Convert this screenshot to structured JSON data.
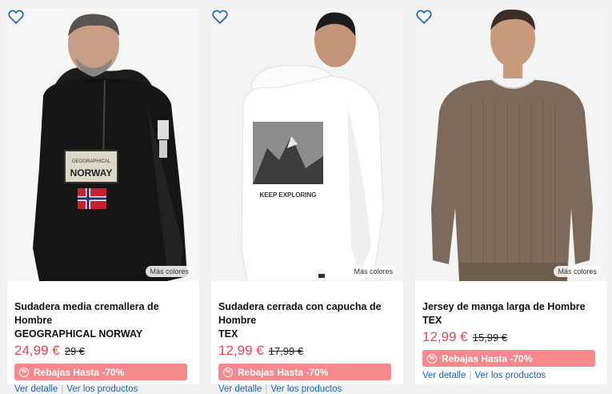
{
  "products": [
    {
      "title_line1": "Sudadera media cremallera de Hombre",
      "title_line2": "GEOGRAPHICAL NORWAY",
      "price": "24,99 €",
      "old_price": "29 €",
      "promo": "Rebajas Hasta -70%",
      "more_colors": "Más colores",
      "link_detail": "Ver detalle",
      "link_products": "Ver los productos",
      "print_text": "NORWAY",
      "print_small": "GEOGRAPHICAL"
    },
    {
      "title_line1": "Sudadera cerrada con capucha de Hombre",
      "title_line2": "TEX",
      "price": "12,99 €",
      "old_price": "17,99 €",
      "promo": "Rebajas Hasta -70%",
      "more_colors": "Más colores",
      "link_detail": "Ver detalle",
      "link_products": "Ver los productos",
      "print_text": "KEEP EXPLORING"
    },
    {
      "title_line1": "Jersey de manga larga de Hombre TEX",
      "price": "12,99 €",
      "old_price": "15,99 €",
      "promo": "Rebajas Hasta -70%",
      "more_colors": "Más colores",
      "link_detail": "Ver detalle",
      "link_products": "Ver los productos"
    }
  ],
  "colors": {
    "price": "#e8484f",
    "promo_bg": "#f5898b",
    "link": "#1a63b5",
    "heart": "#1a63b5"
  },
  "icons": [
    "heart-outline-icon",
    "percent-badge-icon"
  ]
}
